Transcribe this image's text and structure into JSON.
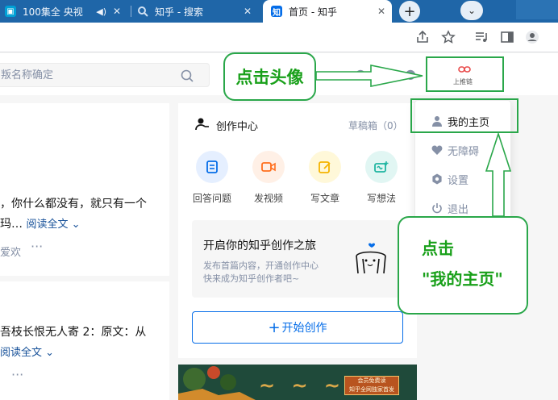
{
  "browser": {
    "tabs": [
      {
        "title": "100集全 央视",
        "favicon": "bilibili-icon",
        "has_audio": true
      },
      {
        "title": "知乎 - 搜索",
        "favicon": "search-icon"
      },
      {
        "title": "首页 - 知乎",
        "favicon": "zhihu-icon",
        "favicon_text": "知",
        "active": true
      }
    ],
    "newtab_label": "+"
  },
  "zhihu": {
    "search": {
      "placeholder": "叛名称确定"
    },
    "link_button_label": "上推链"
  },
  "feed": {
    "item1": {
      "text": "，你什么都没有，就只有一个",
      "text2": "玛…",
      "read_more": "阅读全文",
      "meta": "爱欢"
    },
    "item2": {
      "text": "吾枝长恨无人寄 2：原文：从",
      "read_more": "阅读全文"
    }
  },
  "creation_center": {
    "title": "创作中心",
    "drafts": "草稿箱（0）",
    "tools": [
      {
        "label": "回答问题",
        "icon": "answer-icon"
      },
      {
        "label": "发视频",
        "icon": "video-icon"
      },
      {
        "label": "写文章",
        "icon": "article-icon"
      },
      {
        "label": "写想法",
        "icon": "idea-icon"
      }
    ],
    "promo": {
      "title": "开启你的知乎创作之旅",
      "desc1": "发布首篇内容，开通创作中心",
      "desc2": "快来成为知乎创作者吧~"
    },
    "start_button": "开始创作"
  },
  "banner": {
    "badge_line1": "会员免费读",
    "badge_line2": "知乎全网独家首发"
  },
  "user_menu": {
    "items": [
      {
        "label": "我的主页",
        "icon": "person-icon"
      },
      {
        "label": "无障碍",
        "icon": "heart-icon"
      },
      {
        "label": "设置",
        "icon": "gear-icon"
      },
      {
        "label": "退出",
        "icon": "power-icon"
      }
    ]
  },
  "annotations": {
    "callout_avatar": "点击头像",
    "callout_homepage_l1": "点击",
    "callout_homepage_l2": "\"我的主页\""
  },
  "colors": {
    "annotation_green": "#2aa74a",
    "zhihu_blue": "#056de8",
    "tabstrip": "#1f66a8"
  }
}
